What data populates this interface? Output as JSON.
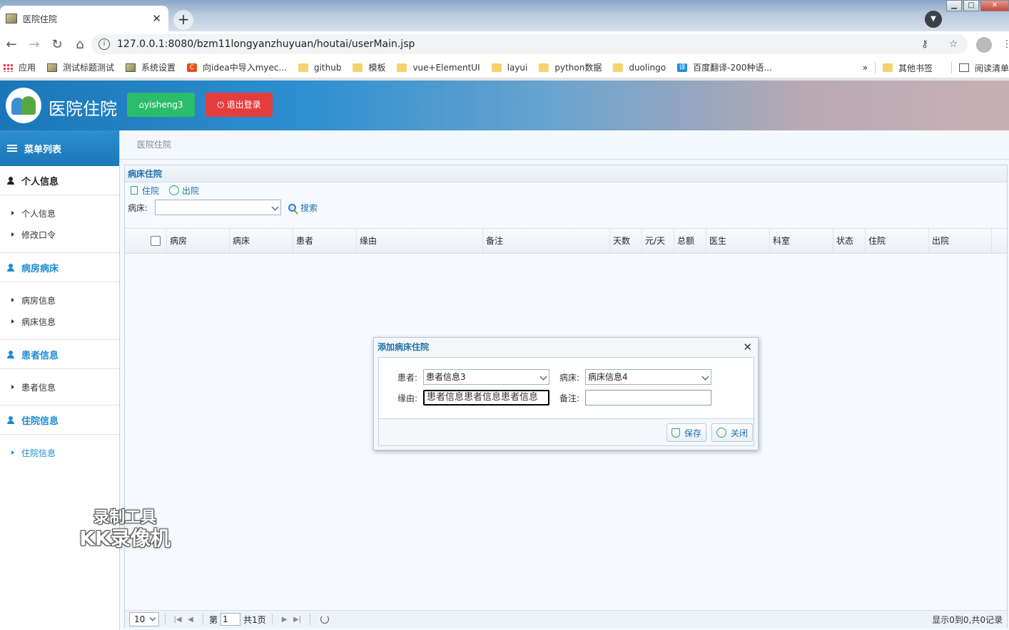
{
  "browser": {
    "tab_title": "医院住院",
    "url": "127.0.0.1:8080/bzm11longyanzhuyuan/houtai/userMain.jsp",
    "bookmarks": [
      "应用",
      "测试标题测试",
      "系统设置",
      "向idea中导入myec...",
      "github",
      "模板",
      "vue+ElementUI",
      "layui",
      "python数据",
      "duolingo",
      "百度翻译-200种语..."
    ],
    "bookmarks_more": "»",
    "other_bookmarks": "其他书签",
    "reading_list": "阅读清单"
  },
  "header": {
    "title": "医院住院",
    "user_button": "yisheng3",
    "logout_button": "退出登录",
    "brand_color": "#1a76b8"
  },
  "sidebar": {
    "heading": "菜单列表",
    "sections": [
      {
        "label": "个人信息",
        "items": [
          "个人信息",
          "修改口令"
        ]
      },
      {
        "label": "病房病床",
        "items": [
          "病房信息",
          "病床信息"
        ]
      },
      {
        "label": "患者信息",
        "items": [
          "患者信息"
        ]
      },
      {
        "label": "住院信息",
        "items": [
          "住院信息"
        ]
      }
    ]
  },
  "main": {
    "breadcrumb": "医院住院",
    "panel_title": "病床住院",
    "actions": {
      "admit": "住院",
      "discharge": "出院"
    },
    "filter": {
      "label": "病床:",
      "value": "",
      "search": "搜索"
    },
    "columns": [
      "病房",
      "病床",
      "患者",
      "缘由",
      "备注",
      "天数",
      "元/天",
      "总额",
      "医生",
      "科室",
      "状态",
      "住院",
      "出院"
    ],
    "pager": {
      "page_size": "10",
      "page_prefix": "第",
      "page": "1",
      "page_suffix": "共1页",
      "info": "显示0到0,共0记录"
    }
  },
  "dialog": {
    "title": "添加病床住院",
    "patient_label": "患者:",
    "patient_value": "患者信息3",
    "bed_label": "病床:",
    "bed_value": "病床信息4",
    "reason_label": "缘由:",
    "reason_value": "患者信息患者信息患者信息",
    "note_label": "备注:",
    "note_value": "",
    "save": "保存",
    "close": "关闭"
  },
  "watermark": {
    "line1": "录制工具",
    "line2": "KK录像机"
  }
}
